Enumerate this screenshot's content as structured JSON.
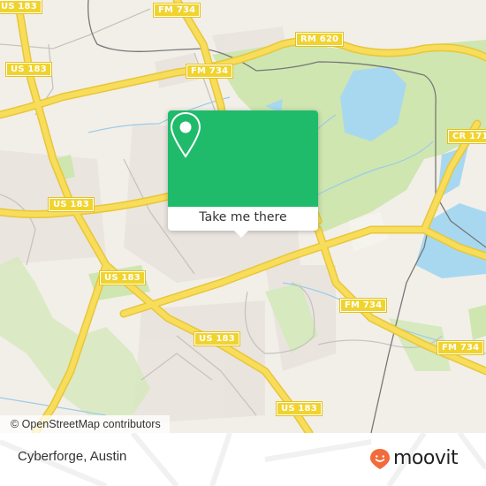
{
  "map": {
    "road_labels": [
      {
        "text": "US 183",
        "id": "us183-top-left"
      },
      {
        "text": "FM 734",
        "id": "fm734-top"
      },
      {
        "text": "RM 620",
        "id": "rm620"
      },
      {
        "text": "US 183",
        "id": "us183-left"
      },
      {
        "text": "FM 734",
        "id": "fm734-upper"
      },
      {
        "text": "CR 171",
        "id": "cr171"
      },
      {
        "text": "US 183",
        "id": "us183-mid"
      },
      {
        "text": "US 183",
        "id": "us183-west"
      },
      {
        "text": "FM 734",
        "id": "fm734-mid"
      },
      {
        "text": "US 183",
        "id": "us183-lower"
      },
      {
        "text": "FM 734",
        "id": "fm734-lower"
      },
      {
        "text": "US 183",
        "id": "us183-bottom"
      }
    ],
    "attribution": "© OpenStreetMap contributors",
    "colors": {
      "land": "#f2efe9",
      "park": "#cfe6b0",
      "water": "#a8d8f0",
      "road": "#f7dd5a",
      "shield": "#f1d32f"
    }
  },
  "popup": {
    "icon": "location-pin-icon",
    "button_label": "Take me there",
    "color": "#1fbb6b"
  },
  "footer": {
    "place_name": "Cyberforge, Austin",
    "logo_text": "moovit",
    "logo_color": "#f26b3a"
  }
}
